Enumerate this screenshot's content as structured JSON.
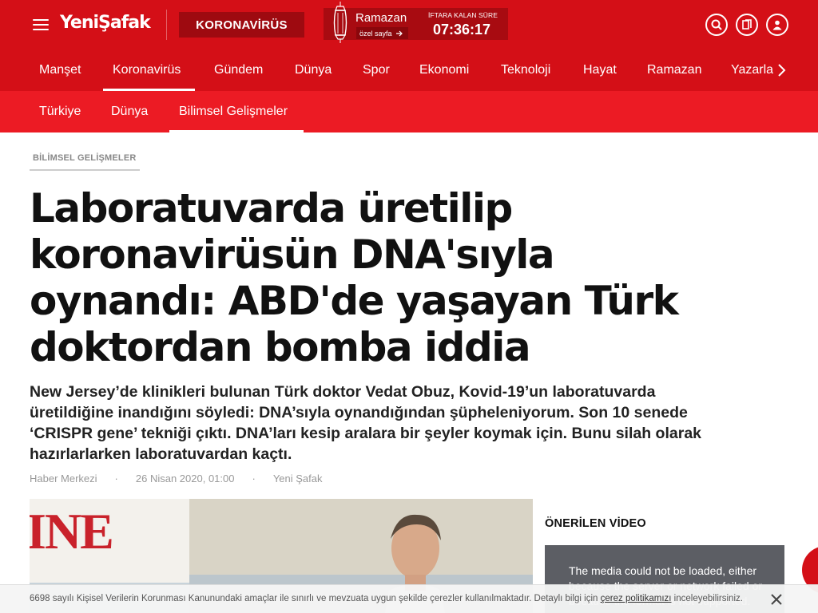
{
  "header": {
    "logo": "YeniŞafak",
    "corona_button": "KORONAVİRÜS",
    "ramazan_title": "Ramazan",
    "ozel_sayfa": "özel sayfa",
    "iftar_label": "İFTARA KALAN SÜRE",
    "iftar_time": "07:36:17",
    "icons": [
      "search-icon",
      "bookmark-icon",
      "user-icon"
    ]
  },
  "main_nav": {
    "items": [
      {
        "label": "Manşet"
      },
      {
        "label": "Koronavirüs"
      },
      {
        "label": "Gündem"
      },
      {
        "label": "Dünya"
      },
      {
        "label": "Spor"
      },
      {
        "label": "Ekonomi"
      },
      {
        "label": "Teknoloji"
      },
      {
        "label": "Hayat"
      },
      {
        "label": "Ramazan"
      },
      {
        "label": "Yazarlar"
      }
    ],
    "active": "Koronavirüs"
  },
  "sub_nav": {
    "items": [
      {
        "label": "Türkiye"
      },
      {
        "label": "Dünya"
      },
      {
        "label": "Bilimsel Gelişmeler"
      }
    ],
    "active": "Bilimsel Gelişmeler"
  },
  "article": {
    "category": "BİLİMSEL GELİŞMELER",
    "headline": "Laboratuvarda üretilip koronavirüsün DNA'sıyla oynandı: ABD'de yaşayan Türk doktordan bomba iddia",
    "summary": "New Jersey’de klinikleri bulunan Türk doktor Vedat Obuz, Kovid-19’un laboratuvarda üretildiğine inandığını söyledi: DNA’sıyla oynandığından şüpheleniyorum. Son 10 senede ‘CRISPR gene’ tekniği çıktı. DNA’ları kesip aralara bir şeyler koymak için. Bunu silah olarak hazırlarlarken laboratuvardan kaçtı.",
    "author": "Haber Merkezi",
    "date": "26 Nisan 2020, 01:00",
    "source": "Yeni Şafak",
    "image_sign_text": "INE"
  },
  "sidebar": {
    "title": "ÖNERİLEN VİDEO",
    "video_error": "The media could not be loaded, either because the server or network failed or because the format is not supported."
  },
  "cookie": {
    "text_before": "6698 sayılı Kişisel Verilerin Korunması Kanunundaki amaçlar ile sınırlı ve mevzuata uygun şekilde çerezler kullanılmaktadır. Detaylı bilgi için ",
    "link": "çerez politikamızı",
    "text_after": " inceleyebilirsiniz."
  },
  "colors": {
    "brand_red": "#d40f17",
    "subnav_red": "#ec1b24",
    "dark_red": "#9e0a10"
  }
}
